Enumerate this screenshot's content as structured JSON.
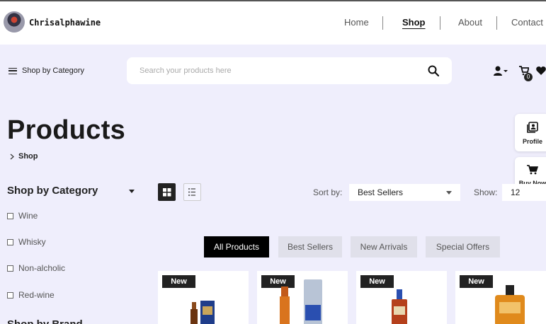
{
  "header": {
    "brand": "Chrisalphawine",
    "nav": [
      {
        "label": "Home",
        "active": false
      },
      {
        "label": "Shop",
        "active": true
      },
      {
        "label": "About",
        "active": false
      },
      {
        "label": "Contact",
        "active": false
      }
    ]
  },
  "toolbar": {
    "category_button": "Shop by Category",
    "search_placeholder": "Search your products here",
    "cart_count": "0",
    "icons": [
      "user-icon",
      "cart-icon",
      "heart-icon",
      "search-icon"
    ]
  },
  "page": {
    "title": "Products",
    "breadcrumb": "Shop"
  },
  "side_actions": {
    "profile": "Profile",
    "buy_now": "Buy Now"
  },
  "sidebar": {
    "heading": "Shop by Category",
    "categories": [
      "Wine",
      "Whisky",
      "Non-alcholic",
      "Red-wine"
    ],
    "next_heading": "Shop by Brand"
  },
  "controls": {
    "sort_label": "Sort by:",
    "sort_value": "Best Sellers",
    "show_label": "Show:",
    "show_value": "12"
  },
  "tabs": [
    "All Products",
    "Best Sellers",
    "New Arrivals",
    "Special Offers"
  ],
  "products": [
    {
      "badge": "New"
    },
    {
      "badge": "New"
    },
    {
      "badge": "New"
    },
    {
      "badge": "New"
    }
  ],
  "colors": {
    "background": "#efeefc",
    "dark": "#222222",
    "tab_inactive": "#e0e0ea"
  }
}
